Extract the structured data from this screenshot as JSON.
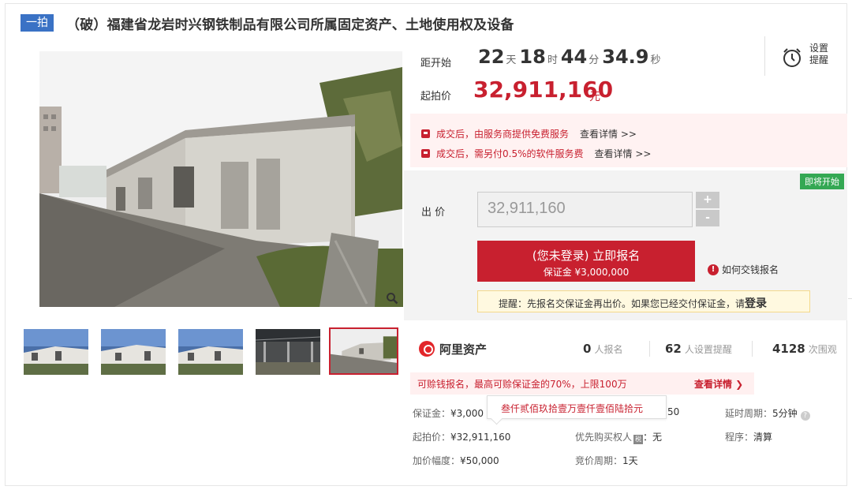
{
  "title": {
    "tag": "一拍",
    "text": "（破）福建省龙岩时兴钢铁制品有限公司所属固定资产、土地使用权及设备"
  },
  "countdown": {
    "label": "距开始",
    "days": "22",
    "days_unit": "天",
    "hours": "18",
    "hours_unit": "时",
    "minutes": "44",
    "minutes_unit": "分",
    "seconds": "34.9",
    "seconds_unit": "秒"
  },
  "remind": {
    "label": "设置提醒",
    "icon": "alarm-clock-icon"
  },
  "start_price": {
    "label": "起拍价",
    "value": "32,911,160",
    "unit": "元"
  },
  "fees": [
    {
      "text": "成交后，由服务商提供免费服务",
      "link": "查看详情 >>"
    },
    {
      "text": "成交后，需另付0.5%的软件服务费",
      "link": "查看详情 >>"
    }
  ],
  "bid": {
    "status_badge": "即将开始",
    "label": "出 价",
    "input_value": "32,911,160",
    "plus": "+",
    "minus": "-",
    "apply_line1": "(您未登录) 立即报名",
    "apply_line2": "保证金 ¥3,000,000",
    "howto": "如何交钱报名",
    "reminder_text": "提醒：先报名交保证金再出价。如果您已经交付保证金，请",
    "reminder_login": "登录"
  },
  "platform": {
    "name": "阿里资产",
    "signups_num": "0",
    "signups_label": "人报名",
    "reminders_num": "62",
    "reminders_label": "人设置提醒",
    "views_num": "4128",
    "views_label": "次围观"
  },
  "promo": {
    "text": "可赊钱报名，最高可赊保证金的70%，上限100万",
    "detail": "查看详情 ❯"
  },
  "info": {
    "deposit_label": "保证金：",
    "deposit_value": "¥3,000",
    "start_label": "起拍价：",
    "start_value": "¥32,911,160",
    "increment_label": "加价幅度：",
    "increment_value": "¥50,000",
    "mid_top_value": "50",
    "priority_label": "优先购买权人",
    "priority_badge": "税",
    "priority_value": "：无",
    "cycle_label": "竞价周期：",
    "cycle_value": "1天",
    "delay_label": "延时周期：",
    "delay_value": "5分钟",
    "procedure_label": "程序：",
    "procedure_value": "清算"
  },
  "tooltip": "叁仟贰佰玖拾壹万壹仟壹佰陆拾元",
  "thumbnails": [
    {
      "name": "thumb-1",
      "active": false
    },
    {
      "name": "thumb-2",
      "active": false
    },
    {
      "name": "thumb-3",
      "active": false
    },
    {
      "name": "thumb-4",
      "active": false
    },
    {
      "name": "thumb-5",
      "active": true
    }
  ],
  "colors": {
    "accent": "#c8202f",
    "tag": "#3a72c5",
    "badge": "#34a853"
  }
}
